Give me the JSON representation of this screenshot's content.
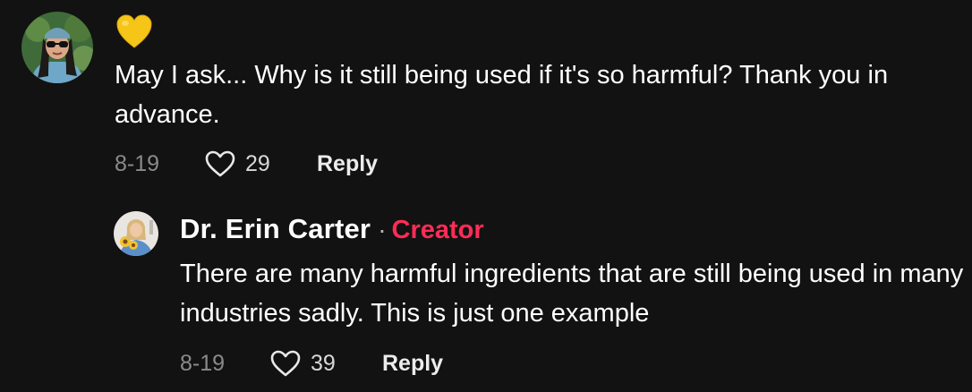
{
  "comments": [
    {
      "emoji": "yellow-heart",
      "text": "May I ask... Why is it still being used if it's so harmful? Thank you in advance.",
      "date": "8-19",
      "likes": "29",
      "reply_label": "Reply"
    }
  ],
  "reply": {
    "author": "Dr. Erin Carter",
    "separator": "·",
    "badge": "Creator",
    "text": "There are many harmful ingredients that are still being used in many industries sadly. This is just one example",
    "date": "8-19",
    "likes": "39",
    "reply_label": "Reply"
  },
  "colors": {
    "background": "#121212",
    "creator_badge": "#fe2c55",
    "secondary_text": "#8a8a8a",
    "yellow_heart": "#f5c518"
  },
  "icons": [
    "user-avatar",
    "yellow-heart-emoji",
    "heart-outline-icon"
  ]
}
